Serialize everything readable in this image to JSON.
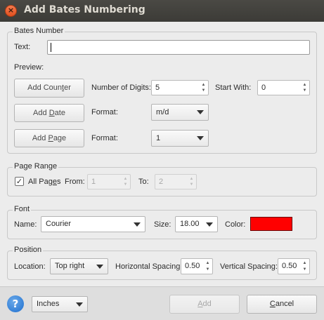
{
  "window": {
    "title": "Add Bates Numbering",
    "close_glyph": "×"
  },
  "bates": {
    "legend": "Bates Number",
    "text_label": "Text:",
    "text_value": "",
    "preview_label": "Preview:",
    "add_counter": {
      "pre": "Add Coun",
      "u": "t",
      "post": "er"
    },
    "add_date": {
      "pre": "Add ",
      "u": "D",
      "post": "ate"
    },
    "add_page": {
      "pre": "Add ",
      "u": "P",
      "post": "age"
    },
    "num_digits_label": "Number of Digits:",
    "num_digits_value": "5",
    "start_with_label": "Start With:",
    "start_with_value": "0",
    "date_format_label": "Format:",
    "date_format_value": "m/d",
    "page_format_label": "Format:",
    "page_format_value": "1"
  },
  "page_range": {
    "legend": "Page Range",
    "all_pages": {
      "pre": "All Pag",
      "u": "e",
      "post": "s"
    },
    "all_pages_checked": true,
    "from_label": "From:",
    "from_value": "1",
    "to_label": "To:",
    "to_value": "2"
  },
  "font": {
    "legend": "Font",
    "name_label": "Name:",
    "name_value": "Courier",
    "size_label": "Size:",
    "size_value": "18.00",
    "color_label": "Color:",
    "color_hex": "#ff0000"
  },
  "position": {
    "legend": "Position",
    "location_label": "Location:",
    "location_value": "Top right",
    "h_spacing_label": "Horizontal Spacing:",
    "h_spacing_value": "0.50",
    "v_spacing_label": "Vertical Spacing:",
    "v_spacing_value": "0.50"
  },
  "footer": {
    "help_glyph": "?",
    "units_value": "Inches",
    "add": {
      "pre": "",
      "u": "A",
      "post": "dd"
    },
    "cancel": {
      "pre": "",
      "u": "C",
      "post": "ancel"
    }
  }
}
